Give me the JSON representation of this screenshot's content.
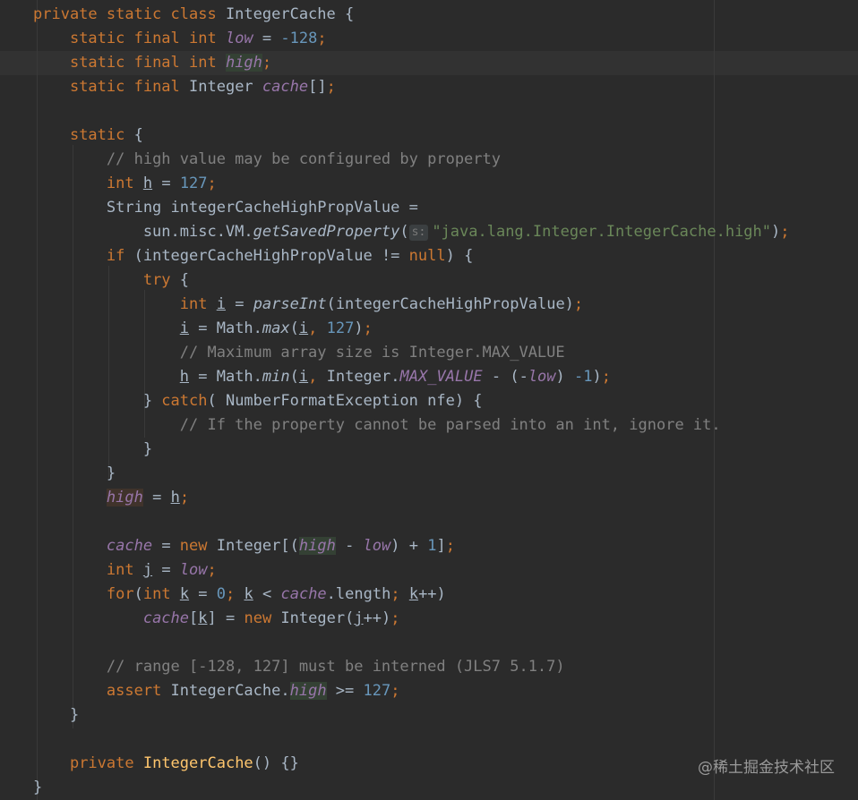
{
  "editor": {
    "lines": [
      [
        {
          "t": "private static class ",
          "c": "kw"
        },
        {
          "t": "IntegerCache {"
        }
      ],
      [
        {
          "t": "    "
        },
        {
          "t": "static final int ",
          "c": "kw"
        },
        {
          "t": "low",
          "c": "fld"
        },
        {
          "t": " = "
        },
        {
          "t": "-128",
          "c": "num"
        },
        {
          "t": ";",
          "c": "kw"
        }
      ],
      [
        {
          "t": "    "
        },
        {
          "t": "static final int ",
          "c": "kw"
        },
        {
          "t": "high",
          "c": "fld hlr"
        },
        {
          "t": ";",
          "c": "kw"
        }
      ],
      [
        {
          "t": "    "
        },
        {
          "t": "static final ",
          "c": "kw"
        },
        {
          "t": "Integer "
        },
        {
          "t": "cache",
          "c": "fld"
        },
        {
          "t": "[]"
        },
        {
          "t": ";",
          "c": "kw"
        }
      ],
      [],
      [
        {
          "t": "    "
        },
        {
          "t": "static ",
          "c": "kw"
        },
        {
          "t": "{"
        }
      ],
      [
        {
          "t": "        "
        },
        {
          "t": "// high value may be configured by property",
          "c": "cmt"
        }
      ],
      [
        {
          "t": "        "
        },
        {
          "t": "int ",
          "c": "kw"
        },
        {
          "t": "h",
          "c": "ul"
        },
        {
          "t": " = "
        },
        {
          "t": "127",
          "c": "num"
        },
        {
          "t": ";",
          "c": "kw"
        }
      ],
      [
        {
          "t": "        String integerCacheHighPropValue ="
        }
      ],
      [
        {
          "t": "            sun.misc.VM."
        },
        {
          "t": "getSavedProperty",
          "c": "fn"
        },
        {
          "t": "("
        },
        {
          "t": "s:",
          "c": "hint"
        },
        {
          "t": "\"java.lang.Integer.IntegerCache.high\"",
          "c": "str"
        },
        {
          "t": ")"
        },
        {
          "t": ";",
          "c": "kw"
        }
      ],
      [
        {
          "t": "        "
        },
        {
          "t": "if ",
          "c": "kw"
        },
        {
          "t": "(integerCacheHighPropValue != "
        },
        {
          "t": "null",
          "c": "kw"
        },
        {
          "t": ") {"
        }
      ],
      [
        {
          "t": "            "
        },
        {
          "t": "try ",
          "c": "kw"
        },
        {
          "t": "{"
        }
      ],
      [
        {
          "t": "                "
        },
        {
          "t": "int ",
          "c": "kw"
        },
        {
          "t": "i",
          "c": "ul"
        },
        {
          "t": " = "
        },
        {
          "t": "parseInt",
          "c": "fn"
        },
        {
          "t": "(integerCacheHighPropValue)"
        },
        {
          "t": ";",
          "c": "kw"
        }
      ],
      [
        {
          "t": "                "
        },
        {
          "t": "i",
          "c": "ul"
        },
        {
          "t": " = Math."
        },
        {
          "t": "max",
          "c": "fn"
        },
        {
          "t": "("
        },
        {
          "t": "i",
          "c": "ul"
        },
        {
          "t": ", ",
          "c": "kw"
        },
        {
          "t": "127",
          "c": "num"
        },
        {
          "t": ")"
        },
        {
          "t": ";",
          "c": "kw"
        }
      ],
      [
        {
          "t": "                "
        },
        {
          "t": "// Maximum array size is Integer.MAX_VALUE",
          "c": "cmt"
        }
      ],
      [
        {
          "t": "                "
        },
        {
          "t": "h",
          "c": "ul"
        },
        {
          "t": " = Math."
        },
        {
          "t": "min",
          "c": "fn"
        },
        {
          "t": "("
        },
        {
          "t": "i",
          "c": "ul"
        },
        {
          "t": ", ",
          "c": "kw"
        },
        {
          "t": "Integer."
        },
        {
          "t": "MAX_VALUE",
          "c": "fld"
        },
        {
          "t": " - (-"
        },
        {
          "t": "low",
          "c": "fld"
        },
        {
          "t": ") "
        },
        {
          "t": "-1",
          "c": "num"
        },
        {
          "t": ")"
        },
        {
          "t": ";",
          "c": "kw"
        }
      ],
      [
        {
          "t": "            } "
        },
        {
          "t": "catch",
          "c": "kw"
        },
        {
          "t": "( NumberFormatException nfe) {"
        }
      ],
      [
        {
          "t": "                "
        },
        {
          "t": "// If the property cannot be parsed into an int, ignore it.",
          "c": "cmt"
        }
      ],
      [
        {
          "t": "            }"
        }
      ],
      [
        {
          "t": "        }"
        }
      ],
      [
        {
          "t": "        "
        },
        {
          "t": "high",
          "c": "fld hlw"
        },
        {
          "t": " = "
        },
        {
          "t": "h",
          "c": "ul"
        },
        {
          "t": ";",
          "c": "kw"
        }
      ],
      [],
      [
        {
          "t": "        "
        },
        {
          "t": "cache",
          "c": "fld"
        },
        {
          "t": " = "
        },
        {
          "t": "new ",
          "c": "kw"
        },
        {
          "t": "Integer[("
        },
        {
          "t": "high",
          "c": "fld hlr"
        },
        {
          "t": " - "
        },
        {
          "t": "low",
          "c": "fld"
        },
        {
          "t": ") + "
        },
        {
          "t": "1",
          "c": "num"
        },
        {
          "t": "]"
        },
        {
          "t": ";",
          "c": "kw"
        }
      ],
      [
        {
          "t": "        "
        },
        {
          "t": "int ",
          "c": "kw"
        },
        {
          "t": "j",
          "c": "ul"
        },
        {
          "t": " = "
        },
        {
          "t": "low",
          "c": "fld"
        },
        {
          "t": ";",
          "c": "kw"
        }
      ],
      [
        {
          "t": "        "
        },
        {
          "t": "for",
          "c": "kw"
        },
        {
          "t": "("
        },
        {
          "t": "int ",
          "c": "kw"
        },
        {
          "t": "k",
          "c": "ul"
        },
        {
          "t": " = "
        },
        {
          "t": "0",
          "c": "num"
        },
        {
          "t": "; ",
          "c": "kw"
        },
        {
          "t": "k",
          "c": "ul"
        },
        {
          "t": " < "
        },
        {
          "t": "cache",
          "c": "fld"
        },
        {
          "t": ".length"
        },
        {
          "t": "; ",
          "c": "kw"
        },
        {
          "t": "k",
          "c": "ul"
        },
        {
          "t": "++)"
        }
      ],
      [
        {
          "t": "            "
        },
        {
          "t": "cache",
          "c": "fld"
        },
        {
          "t": "["
        },
        {
          "t": "k",
          "c": "ul"
        },
        {
          "t": "] = "
        },
        {
          "t": "new ",
          "c": "kw"
        },
        {
          "t": "Integer("
        },
        {
          "t": "j",
          "c": "ul"
        },
        {
          "t": "++)"
        },
        {
          "t": ";",
          "c": "kw"
        }
      ],
      [],
      [
        {
          "t": "        "
        },
        {
          "t": "// range [-128, 127] must be interned (JLS7 5.1.7)",
          "c": "cmt"
        }
      ],
      [
        {
          "t": "        "
        },
        {
          "t": "assert ",
          "c": "kw"
        },
        {
          "t": "IntegerCache."
        },
        {
          "t": "high",
          "c": "fld hlr"
        },
        {
          "t": " >= "
        },
        {
          "t": "127",
          "c": "num"
        },
        {
          "t": ";",
          "c": "kw"
        }
      ],
      [
        {
          "t": "    }"
        }
      ],
      [],
      [
        {
          "t": "    "
        },
        {
          "t": "private ",
          "c": "kw"
        },
        {
          "t": "IntegerCache",
          "c": "fnc"
        },
        {
          "t": "() {}"
        }
      ],
      [
        {
          "t": "}"
        }
      ]
    ]
  },
  "watermark": "@稀土掘金技术社区"
}
